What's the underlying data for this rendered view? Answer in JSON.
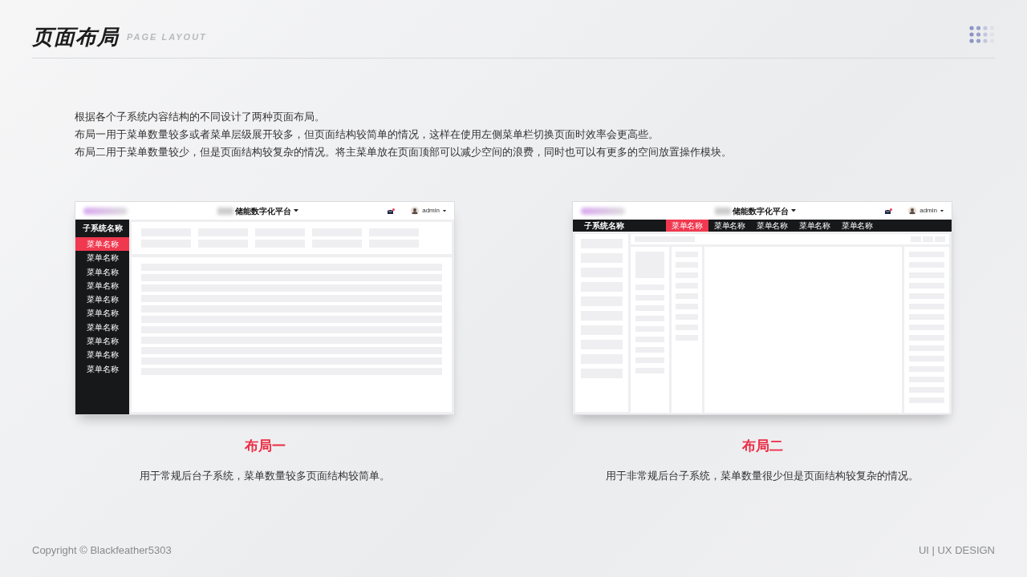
{
  "header": {
    "title": "页面布局",
    "subtitle": "PAGE LAYOUT"
  },
  "intro": [
    "根据各个子系统内容结构的不同设计了两种页面布局。",
    "布局一用于菜单数量较多或者菜单层级展开较多，但页面结构较简单的情况，这样在使用左侧菜单栏切换页面时效率会更高些。",
    "布局二用于菜单数量较少，但是页面结构较复杂的情况。将主菜单放在页面顶部可以减少空间的浪费，同时也可以有更多的空间放置操作模块。"
  ],
  "layouts": [
    {
      "kind": "sidebar",
      "platform_title": "储能数字化平台",
      "user": "admin",
      "subsystem": "子系统名称",
      "menu": [
        {
          "label": "菜单名称",
          "selected": true
        },
        {
          "label": "菜单名称",
          "selected": false
        },
        {
          "label": "菜单名称",
          "selected": false
        },
        {
          "label": "菜单名称",
          "selected": false
        },
        {
          "label": "菜单名称",
          "selected": false
        },
        {
          "label": "菜单名称",
          "selected": false
        },
        {
          "label": "菜单名称",
          "selected": false
        },
        {
          "label": "菜单名称",
          "selected": false
        },
        {
          "label": "菜单名称",
          "selected": false
        },
        {
          "label": "菜单名称",
          "selected": false
        }
      ],
      "caption": "布局一",
      "description": "用于常规后台子系统，菜单数量较多页面结构较简单。"
    },
    {
      "kind": "topnav",
      "platform_title": "储能数字化平台",
      "user": "admin",
      "subsystem": "子系统名称",
      "menu": [
        {
          "label": "菜单名称",
          "selected": true
        },
        {
          "label": "菜单名称",
          "selected": false
        },
        {
          "label": "菜单名称",
          "selected": false
        },
        {
          "label": "菜单名称",
          "selected": false
        },
        {
          "label": "菜单名称",
          "selected": false
        }
      ],
      "caption": "布局二",
      "description": "用于非常规后台子系统，菜单数量很少但是页面结构较复杂的情况。"
    }
  ],
  "footer": {
    "copyright": "Copyright © Blackfeather5303",
    "tag": "UI | UX DESIGN"
  }
}
